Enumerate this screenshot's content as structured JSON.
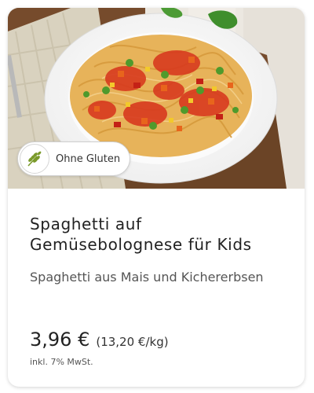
{
  "product": {
    "badge_label": "Ohne Gluten",
    "title": "Spaghetti auf Gemüsebolognese für Kids",
    "subtitle": "Spaghetti aus Mais und Kichererbsen",
    "price": "3,96 €",
    "unit_price": "(13,20 €/kg)",
    "tax_note": "inkl. 7% MwSt."
  },
  "colors": {
    "badge_icon": "#7a9a2a",
    "text_primary": "#222222",
    "text_secondary": "#555555"
  }
}
